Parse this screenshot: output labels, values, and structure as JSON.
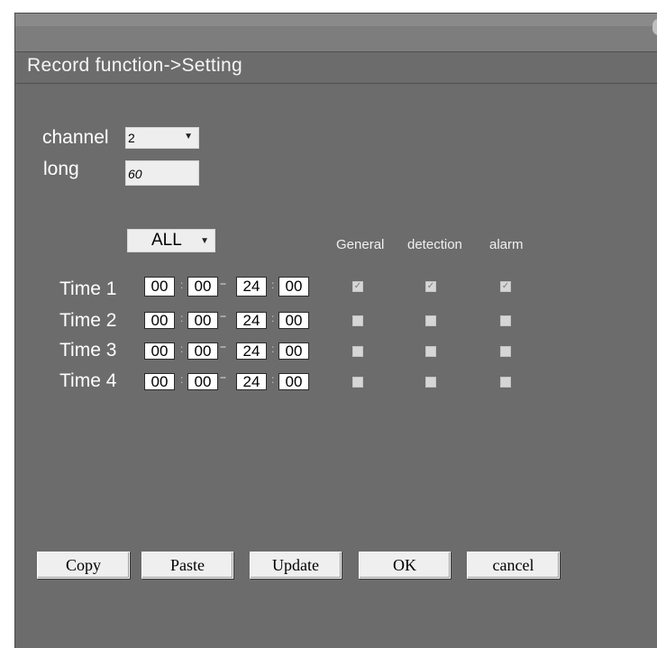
{
  "window": {
    "title": "Record function->Setting"
  },
  "form": {
    "channel_label": "channel",
    "channel_value": "2",
    "long_label": "long",
    "long_value": "60",
    "all_value": "ALL"
  },
  "columns": [
    "General",
    "detection",
    "alarm"
  ],
  "rows": [
    {
      "label": "Time 1",
      "start_h": "00",
      "start_m": "00",
      "end_h": "24",
      "end_m": "00",
      "checks": [
        true,
        true,
        true
      ]
    },
    {
      "label": "Time 2",
      "start_h": "00",
      "start_m": "00",
      "end_h": "24",
      "end_m": "00",
      "checks": [
        false,
        false,
        false
      ]
    },
    {
      "label": "Time 3",
      "start_h": "00",
      "start_m": "00",
      "end_h": "24",
      "end_m": "00",
      "checks": [
        false,
        false,
        false
      ]
    },
    {
      "label": "Time 4",
      "start_h": "00",
      "start_m": "00",
      "end_h": "24",
      "end_m": "00",
      "checks": [
        false,
        false,
        false
      ]
    }
  ],
  "buttons": {
    "copy": "Copy",
    "paste": "Paste",
    "update": "Update",
    "ok": "OK",
    "cancel": "cancel"
  },
  "colors": {
    "panel": "#6c6c6c",
    "field": "#ffffff",
    "button": "#efefef"
  }
}
